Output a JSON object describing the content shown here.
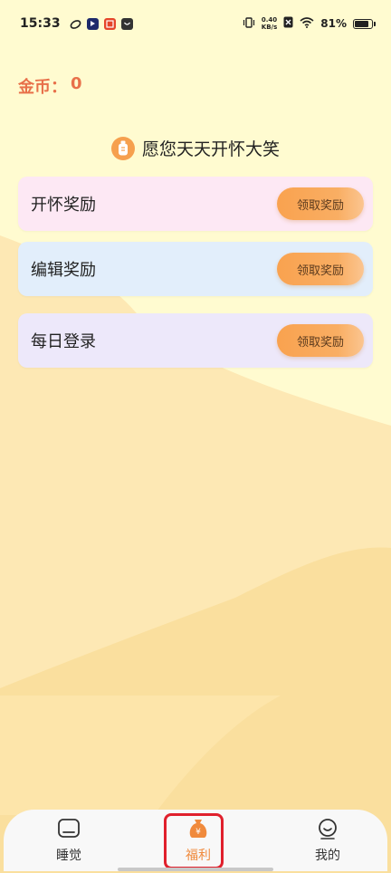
{
  "status_bar": {
    "time": "15:33",
    "net_speed_value": "0.40",
    "net_speed_unit": "KB/s",
    "battery": "81%",
    "battery_level": 0.81
  },
  "header": {
    "coins_label": "金币：",
    "coins_value": "0"
  },
  "slogan": "愿您天天开怀大笑",
  "rewards": [
    {
      "title": "开怀奖励",
      "button": "领取奖励",
      "bg": "#fde8f4"
    },
    {
      "title": "编辑奖励",
      "button": "领取奖励",
      "bg": "#e2eefb"
    },
    {
      "title": "每日登录",
      "button": "领取奖励",
      "bg": "#ede8fa"
    }
  ],
  "tabs": [
    {
      "label": "睡觉",
      "icon": "home-box-icon",
      "active": false
    },
    {
      "label": "福利",
      "icon": "money-bag-icon",
      "active": true
    },
    {
      "label": "我的",
      "icon": "smiley-face-icon",
      "active": false
    }
  ],
  "colors": {
    "accent": "#f08a3c",
    "coins_text": "#e8704a",
    "highlight_box": "#e0202c",
    "background": "#fffbd0"
  }
}
